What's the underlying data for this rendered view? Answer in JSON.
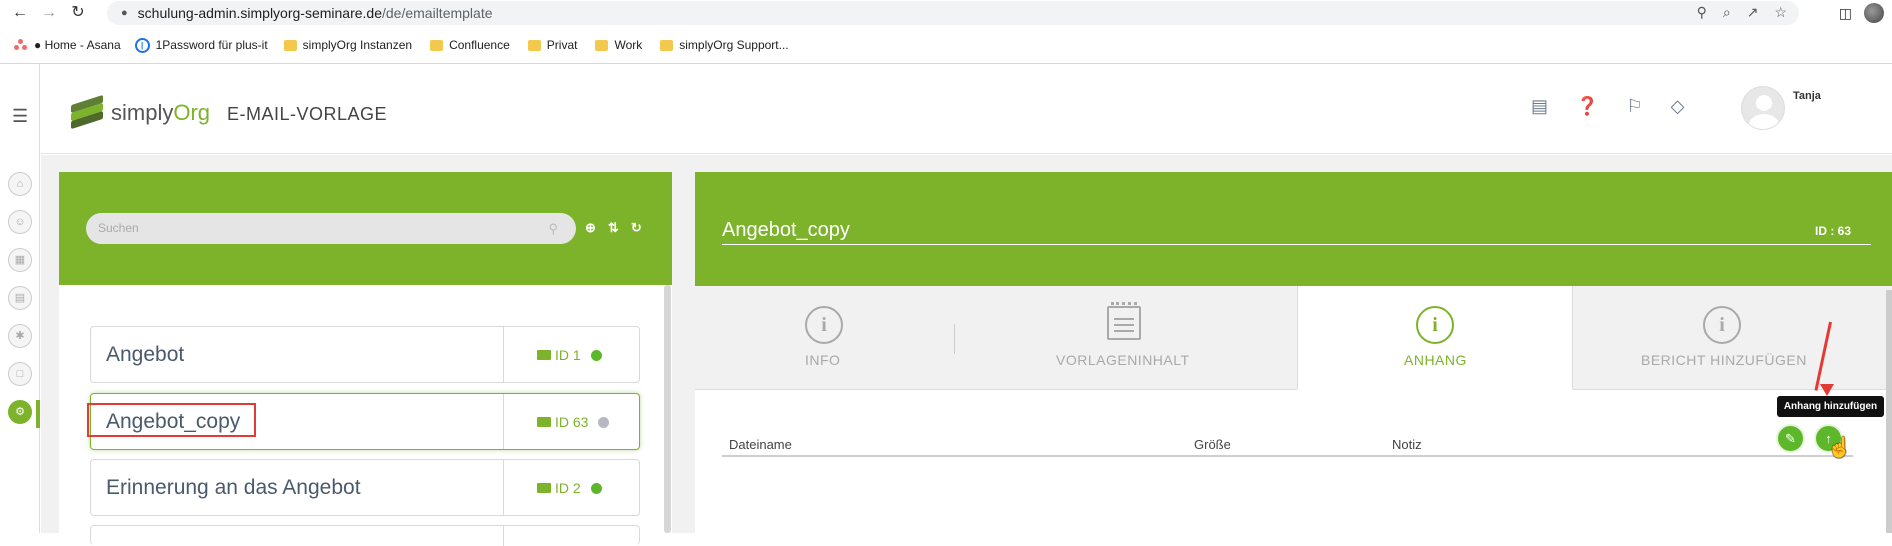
{
  "browser": {
    "url_host": "schulung-admin.simplyorg-seminare.de",
    "url_path": "/de/emailtemplate",
    "bookmarks": [
      {
        "label": "● Home - Asana",
        "icon": "asana-icon"
      },
      {
        "label": "1Password für plus-it",
        "icon": "1password-icon"
      },
      {
        "label": "simplyOrg Instanzen",
        "icon": "folder-icon"
      },
      {
        "label": "Confluence",
        "icon": "folder-icon"
      },
      {
        "label": "Privat",
        "icon": "folder-icon"
      },
      {
        "label": "Work",
        "icon": "folder-icon"
      },
      {
        "label": "simplyOrg Support...",
        "icon": "folder-icon"
      }
    ]
  },
  "header": {
    "logo_simply": "simply",
    "logo_org": "Org",
    "page_title": "E-MAIL-VORLAGE",
    "user_name": "Tanja"
  },
  "left_panel": {
    "search_placeholder": "Suchen",
    "templates": [
      {
        "name": "Angebot",
        "id_label": "ID 1",
        "status_color": "#5cb82a"
      },
      {
        "name": "Angebot_copy",
        "id_label": "ID 63",
        "status_color": "#b8b8c4"
      },
      {
        "name": "Erinnerung an das Angebot",
        "id_label": "ID 2",
        "status_color": "#5cb82a"
      }
    ]
  },
  "detail": {
    "title": "Angebot_copy",
    "id_label": "ID : 63",
    "tabs": [
      {
        "label": "INFO",
        "icon": "info-icon"
      },
      {
        "label": "VORLAGENINHALT",
        "icon": "notepad-icon"
      },
      {
        "label": "ANHANG",
        "icon": "info-icon"
      },
      {
        "label": "BERICHT HINZUFÜGEN",
        "icon": "info-icon"
      }
    ],
    "active_tab": "ANHANG",
    "table_headers": [
      "Dateiname",
      "Größe",
      "Notiz"
    ],
    "tooltip": "Anhang hinzufügen"
  },
  "colors": {
    "accent": "#7cb32b",
    "button_green": "#5cb82a",
    "annotation_red": "#e53935"
  }
}
